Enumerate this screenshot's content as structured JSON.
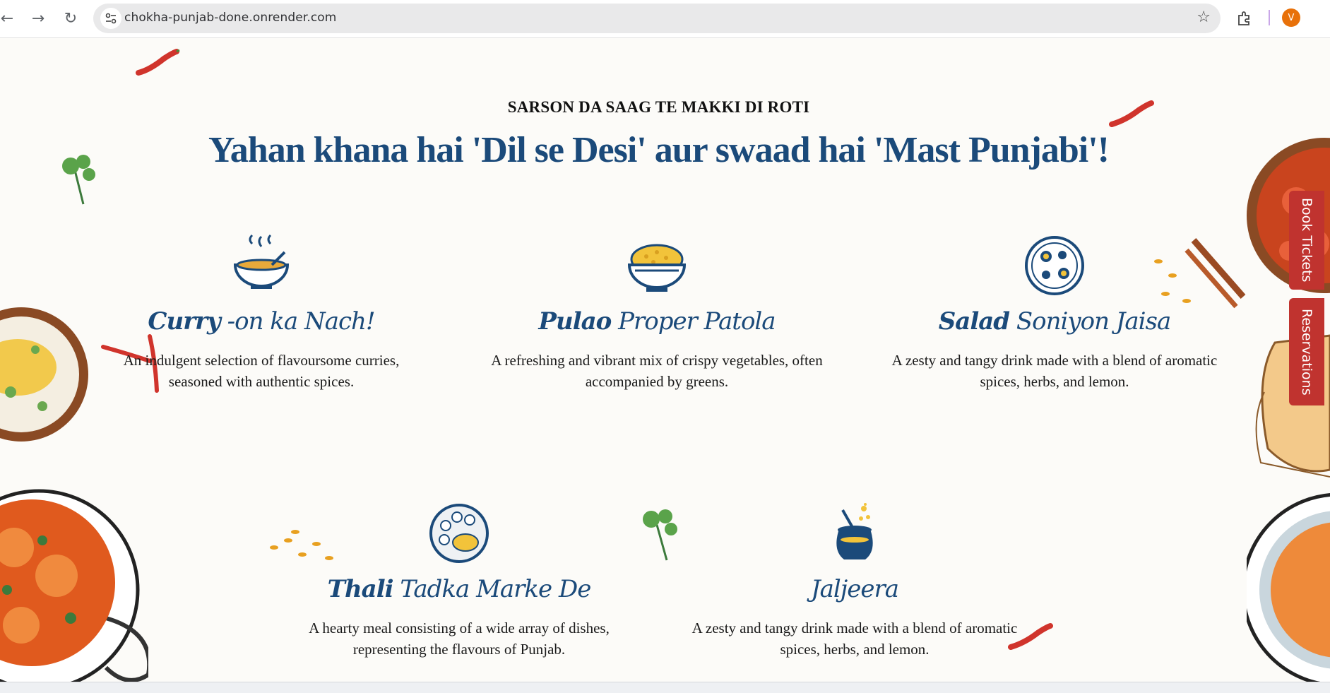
{
  "browser": {
    "url": "chokha-punjab-done.onrender.com",
    "profile_initial": "V",
    "icons": {
      "back": "arrow-left-icon",
      "forward": "arrow-right-icon",
      "reload": "reload-icon",
      "site_info": "tune-icon",
      "bookmark": "star-icon",
      "extensions": "puzzle-icon"
    }
  },
  "hero": {
    "eyebrow": "SARSON DA SAAG TE MAKKI DI ROTI",
    "headline": "Yahan khana hai 'Dil se Desi' aur swaad hai 'Mast Punjabi'!"
  },
  "menu": [
    {
      "title_bold": "Curry",
      "title_rest": " -on ka Nach!",
      "description": "An indulgent selection of flavoursome curries, seasoned with authentic spices.",
      "icon": "curry-bowl-icon"
    },
    {
      "title_bold": "Pulao",
      "title_rest": " Proper Patola",
      "description": "A refreshing and vibrant mix of crispy vegetables, often accompanied by greens.",
      "icon": "pulao-bowl-icon"
    },
    {
      "title_bold": "Salad",
      "title_rest": " Soniyon Jaisa",
      "description": "A zesty and tangy drink made with a blend of aromatic spices, herbs, and lemon.",
      "icon": "salad-plate-icon"
    },
    {
      "title_bold": "Thali",
      "title_rest": " Tadka Marke De",
      "description": "A hearty meal consisting of a wide array of dishes, representing the flavours of Punjab.",
      "icon": "thali-plate-icon"
    },
    {
      "title_bold": "",
      "title_rest": "Jaljeera",
      "description": "A zesty and tangy drink made with a blend of aromatic spices, herbs, and lemon.",
      "icon": "jaljeera-pot-icon"
    }
  ],
  "side_tabs": {
    "book": "Book Tickets",
    "reservations": "Reservations"
  },
  "colors": {
    "heading_blue": "#1b4a7a",
    "tab_red": "#c0332f",
    "page_bg": "#fcfbf8"
  }
}
